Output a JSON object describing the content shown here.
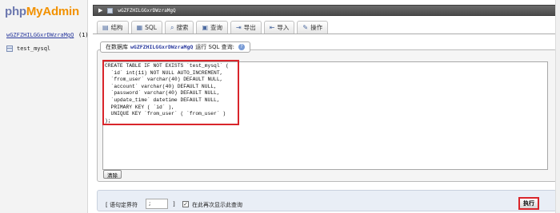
{
  "sidebar": {
    "logo_part1": "php",
    "logo_part2": "MyAdmin",
    "database_link": "wGZFZHILGGxrDWzraMgQ",
    "database_count": "(1)",
    "tables": [
      {
        "name": "test_mysql",
        "icon": "table-icon"
      }
    ]
  },
  "breadcrumb": {
    "text": "wGZFZHILGGxrDWzraMgQ",
    "icons": [
      "triangle-right-icon",
      "server-icon"
    ]
  },
  "tabs": [
    {
      "label": "结构",
      "icon": "structure-icon"
    },
    {
      "label": "SQL",
      "icon": "sql-icon"
    },
    {
      "label": "搜索",
      "icon": "search-icon"
    },
    {
      "label": "查询",
      "icon": "query-icon"
    },
    {
      "label": "导出",
      "icon": "export-icon"
    },
    {
      "label": "导入",
      "icon": "import-icon"
    },
    {
      "label": "操作",
      "icon": "wrench-icon"
    }
  ],
  "query_panel": {
    "legend_prefix": "在数据库",
    "legend_db": "wGZFZHILGGxrDWzraMgQ",
    "legend_suffix": "运行 SQL 查询:",
    "sql": "CREATE TABLE IF NOT EXISTS `test_mysql` (\n  `id` int(11) NOT NULL AUTO_INCREMENT,\n  `from_user` varchar(40) DEFAULT NULL,\n  `account` varchar(40) DEFAULT NULL,\n  `password` varchar(40) DEFAULT NULL,\n  `update_time` datetime DEFAULT NULL,\n  PRIMARY KEY ( `id` ),\n  UNIQUE KEY `from_user` ( `from_user` )\n);",
    "clear_button": "清除"
  },
  "footer": {
    "delimiter_label": "[ 语句定界符",
    "delimiter_value": ";",
    "delimiter_close": "]",
    "show_again_checked": true,
    "show_again_label": "在此再次显示此查询",
    "go_button": "执行"
  },
  "colors": {
    "highlight": "#d9252b",
    "logo_php": "#6c78af",
    "logo_myadmin": "#f29100",
    "topbar": "#4a4a4a"
  }
}
